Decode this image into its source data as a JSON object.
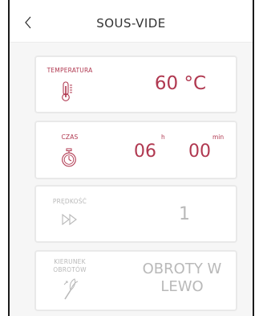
{
  "header": {
    "title": "SOUS-VIDE",
    "back_icon": "chevron-left-icon"
  },
  "colors": {
    "accent": "#b03850",
    "disabled": "#b9b9b9",
    "card_border": "#e9e9e9",
    "background": "#f6f6f6"
  },
  "temperature": {
    "label": "TEMPERATURA",
    "value": "60 °C",
    "icon": "thermometer-icon"
  },
  "time": {
    "label": "CZAS",
    "hours": "06",
    "hours_unit": "h",
    "minutes": "00",
    "minutes_unit": "min",
    "icon": "stopwatch-icon"
  },
  "speed": {
    "label": "PRĘDKOŚĆ",
    "value": "1",
    "icon": "fast-forward-icon"
  },
  "direction": {
    "label_line1": "KIERUNEK",
    "label_line2": "OBROTÓW",
    "value_line1": "OBROTY W",
    "value_line2": "LEWO",
    "icon": "whisk-icon"
  }
}
